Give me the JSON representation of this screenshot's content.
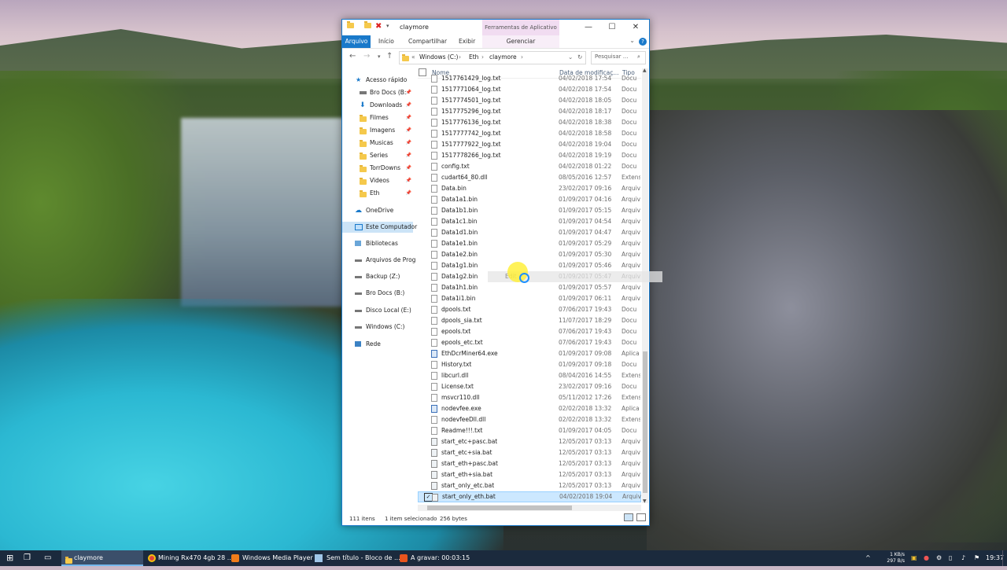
{
  "window": {
    "title": "claymore",
    "context_tab": "Ferramentas de Aplicativo",
    "minimize": "—",
    "maximize": "☐",
    "close": "✕"
  },
  "ribbon": {
    "tabs": [
      "Arquivo",
      "Início",
      "Compartilhar",
      "Exibir"
    ],
    "manage": "Gerenciar",
    "help": "?"
  },
  "address": {
    "overflow": "«",
    "crumbs": [
      "Windows (C:)",
      "Eth",
      "claymore"
    ],
    "search_placeholder": "Pesquisar ..."
  },
  "nav": {
    "items": [
      {
        "label": "Acesso rápido",
        "icon": "star-icon"
      },
      {
        "label": "Bro Docs (B:",
        "icon": "drive-icon"
      },
      {
        "label": "Downloads",
        "icon": "download-icon"
      },
      {
        "label": "Filmes",
        "icon": "folder-icon"
      },
      {
        "label": "Imagens",
        "icon": "folder-icon"
      },
      {
        "label": "Musicas",
        "icon": "folder-icon"
      },
      {
        "label": "Series",
        "icon": "folder-icon"
      },
      {
        "label": "TorrDowns",
        "icon": "folder-icon"
      },
      {
        "label": "Videos",
        "icon": "folder-icon"
      },
      {
        "label": "Eth",
        "icon": "folder-icon"
      },
      {
        "label": "OneDrive",
        "icon": "cloud-icon"
      },
      {
        "label": "Este Computador",
        "icon": "computer-icon"
      },
      {
        "label": "Bibliotecas",
        "icon": "library-icon"
      },
      {
        "label": "Arquivos de Prog",
        "icon": "drive-icon"
      },
      {
        "label": "Backup (Z:)",
        "icon": "drive-icon"
      },
      {
        "label": "Bro Docs (B:)",
        "icon": "drive-icon"
      },
      {
        "label": "Disco Local (E:)",
        "icon": "drive-icon"
      },
      {
        "label": "Windows (C:)",
        "icon": "drive-icon"
      },
      {
        "label": "Rede",
        "icon": "network-icon"
      }
    ],
    "pin": "📌"
  },
  "list": {
    "columns": [
      "Nome",
      "Data de modificaç...",
      "Tipo"
    ],
    "rows": [
      {
        "name": "1517761429_log.txt",
        "date": "04/02/2018 17:54",
        "type": "Docu"
      },
      {
        "name": "1517771064_log.txt",
        "date": "04/02/2018 17:54",
        "type": "Docu"
      },
      {
        "name": "1517774501_log.txt",
        "date": "04/02/2018 18:05",
        "type": "Docu"
      },
      {
        "name": "1517775296_log.txt",
        "date": "04/02/2018 18:17",
        "type": "Docu"
      },
      {
        "name": "1517776136_log.txt",
        "date": "04/02/2018 18:38",
        "type": "Docu"
      },
      {
        "name": "1517777742_log.txt",
        "date": "04/02/2018 18:58",
        "type": "Docu"
      },
      {
        "name": "1517777922_log.txt",
        "date": "04/02/2018 19:04",
        "type": "Docu"
      },
      {
        "name": "1517778266_log.txt",
        "date": "04/02/2018 19:19",
        "type": "Docu"
      },
      {
        "name": "config.txt",
        "date": "04/02/2018 01:22",
        "type": "Docu"
      },
      {
        "name": "cudart64_80.dll",
        "date": "08/05/2016 12:57",
        "type": "Extens"
      },
      {
        "name": "Data.bin",
        "date": "23/02/2017 09:16",
        "type": "Arquiv"
      },
      {
        "name": "Data1a1.bin",
        "date": "01/09/2017 04:16",
        "type": "Arquiv"
      },
      {
        "name": "Data1b1.bin",
        "date": "01/09/2017 05:15",
        "type": "Arquiv"
      },
      {
        "name": "Data1c1.bin",
        "date": "01/09/2017 04:54",
        "type": "Arquiv"
      },
      {
        "name": "Data1d1.bin",
        "date": "01/09/2017 04:47",
        "type": "Arquiv"
      },
      {
        "name": "Data1e1.bin",
        "date": "01/09/2017 05:29",
        "type": "Arquiv"
      },
      {
        "name": "Data1e2.bin",
        "date": "01/09/2017 05:30",
        "type": "Arquiv"
      },
      {
        "name": "Data1g1.bin",
        "date": "01/09/2017 05:46",
        "type": "Arquiv"
      },
      {
        "name": "Data1g2.bin",
        "date": "01/09/2017 05:47",
        "type": "Arquiv"
      },
      {
        "name": "Data1h1.bin",
        "date": "01/09/2017 05:57",
        "type": "Arquiv"
      },
      {
        "name": "Data1i1.bin",
        "date": "01/09/2017 06:11",
        "type": "Arquiv"
      },
      {
        "name": "dpools.txt",
        "date": "07/06/2017 19:43",
        "type": "Docu"
      },
      {
        "name": "dpools_sia.txt",
        "date": "11/07/2017 18:29",
        "type": "Docu"
      },
      {
        "name": "epools.txt",
        "date": "07/06/2017 19:43",
        "type": "Docu"
      },
      {
        "name": "epools_etc.txt",
        "date": "07/06/2017 19:43",
        "type": "Docu"
      },
      {
        "name": "EthDcrMiner64.exe",
        "date": "01/09/2017 09:08",
        "type": "Aplica"
      },
      {
        "name": "History.txt",
        "date": "01/09/2017 09:18",
        "type": "Docu"
      },
      {
        "name": "libcurl.dll",
        "date": "08/04/2016 14:55",
        "type": "Extens"
      },
      {
        "name": "License.txt",
        "date": "23/02/2017 09:16",
        "type": "Docu"
      },
      {
        "name": "msvcr110.dll",
        "date": "05/11/2012 17:26",
        "type": "Extens"
      },
      {
        "name": "nodevfee.exe",
        "date": "02/02/2018 13:32",
        "type": "Aplica"
      },
      {
        "name": "nodevfeeDll.dll",
        "date": "02/02/2018 13:32",
        "type": "Extens"
      },
      {
        "name": "Readme!!!.txt",
        "date": "01/09/2017 04:05",
        "type": "Docu"
      },
      {
        "name": "start_etc+pasc.bat",
        "date": "12/05/2017 03:13",
        "type": "Arquiv"
      },
      {
        "name": "start_etc+sia.bat",
        "date": "12/05/2017 03:13",
        "type": "Arquiv"
      },
      {
        "name": "start_eth+pasc.bat",
        "date": "12/05/2017 03:13",
        "type": "Arquiv"
      },
      {
        "name": "start_eth+sia.bat",
        "date": "12/05/2017 03:13",
        "type": "Arquiv"
      },
      {
        "name": "start_only_etc.bat",
        "date": "12/05/2017 03:13",
        "type": "Arquiv"
      },
      {
        "name": "start_only_eth.bat",
        "date": "04/02/2018 19:04",
        "type": "Arquiv"
      }
    ],
    "selected_check": "✓"
  },
  "drag_label": "Edit",
  "status": {
    "count": "111 itens",
    "selected": "1 item selecionado",
    "size": "256 bytes"
  },
  "taskbar": {
    "items": [
      {
        "label": "claymore"
      },
      {
        "label": "Mining Rx470 4gb 28 ..."
      },
      {
        "label": "Windows Media Player"
      },
      {
        "label": "Sem título - Bloco de ..."
      },
      {
        "label": "A gravar: 00:03:15"
      }
    ],
    "net_up": "1 KB/s",
    "net_down": "297 B/s",
    "clock": "19:37"
  },
  "colors": {
    "accent": "#1979ca",
    "selection": "#cce8ff",
    "taskbar": "#1b2a3d"
  }
}
